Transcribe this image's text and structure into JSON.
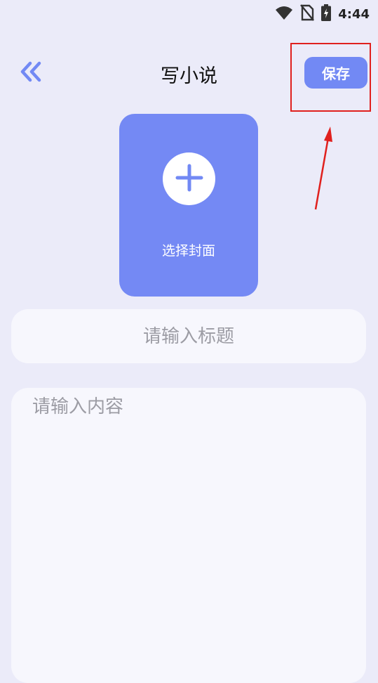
{
  "status_bar": {
    "time": "4:44",
    "icons": [
      "wifi-icon",
      "no-sim-icon",
      "battery-charging-icon"
    ]
  },
  "header": {
    "back_icon": "double-chevron-left-icon",
    "title": "写小说",
    "save_label": "保存"
  },
  "cover": {
    "icon": "plus-icon",
    "label": "选择封面"
  },
  "form": {
    "title_placeholder": "请输入标题",
    "title_value": "",
    "content_placeholder": "请输入内容",
    "content_value": ""
  },
  "colors": {
    "background": "#ebebf9",
    "accent": "#7289f4",
    "field_background": "#f7f7fd",
    "annotation": "#e0201e"
  }
}
